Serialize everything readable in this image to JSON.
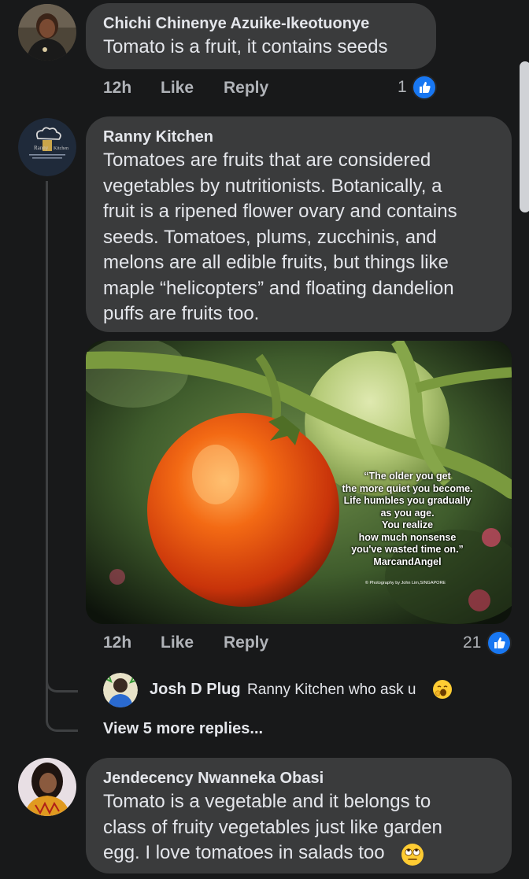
{
  "comments": [
    {
      "author": "Chichi Chinenye Azuike-Ikeotuonye",
      "text": "Tomato is a fruit, it contains seeds",
      "time": "12h",
      "like_label": "Like",
      "reply_label": "Reply",
      "reaction_count": "1",
      "reaction_icon": "like-icon"
    },
    {
      "author": "Ranny Kitchen",
      "text_lines": [
        "Tomatoes are fruits that are considered",
        "vegetables by nutritionists. Botanically, a",
        "fruit is a ripened flower ovary and contains",
        "seeds. Tomatoes, plums, zucchinis, and",
        "melons are all edible fruits, but things like",
        "maple “helicopters” and floating dandelion",
        "puffs are fruits too."
      ],
      "image": {
        "quote": "“The older you get\nthe more quiet you become.\nLife humbles you gradually\nas you age.\nYou realize\nhow much nonsense\nyou've wasted time on.”\nMarcandAngel",
        "credit": "© Photography by John Lim,SINGAPORE"
      },
      "time": "12h",
      "like_label": "Like",
      "reply_label": "Reply",
      "reaction_count": "21",
      "reaction_icon": "like-icon"
    },
    {
      "author": "Jendecency Nwanneka Obasi",
      "text_lines": [
        "Tomato is a vegetable and it belongs to",
        "class of fruity vegetables just like garden",
        "egg. I love tomatoes in salads too"
      ],
      "trailing_emoji": "rolling-eyes-emoji"
    }
  ],
  "reply": {
    "author": "Josh D Plug",
    "text": "Ranny Kitchen who ask u",
    "trailing_emoji": "yawning-face-emoji"
  },
  "view_more": "View 5 more replies...",
  "colors": {
    "background": "#18191a",
    "bubble": "#3a3b3c",
    "text": "#e4e6eb",
    "secondary_text": "#b0b3b8",
    "like_blue": "#1877f2"
  }
}
